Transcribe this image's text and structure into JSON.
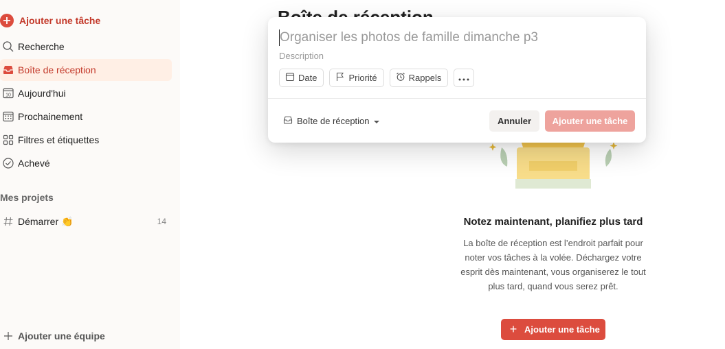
{
  "sidebar": {
    "add_task": "Ajouter une tâche",
    "items": [
      {
        "label": "Recherche",
        "icon": "search-icon"
      },
      {
        "label": "Boîte de réception",
        "icon": "inbox-icon"
      },
      {
        "label": "Aujourd'hui",
        "icon": "calendar-today-icon",
        "icon_number": "10"
      },
      {
        "label": "Prochainement",
        "icon": "calendar-grid-icon"
      },
      {
        "label": "Filtres et étiquettes",
        "icon": "filters-icon"
      },
      {
        "label": "Achevé",
        "icon": "check-circle-icon"
      }
    ],
    "projects_title": "Mes projets",
    "projects": [
      {
        "label": "Démarrer 👏",
        "count": "14",
        "icon": "hash-icon"
      }
    ],
    "add_team": "Ajouter une équipe"
  },
  "main": {
    "title": "Boîte de réception",
    "empty_title": "Notez maintenant, planifiez plus tard",
    "empty_desc": "La boîte de réception est l’endroit parfait pour noter vos tâches à la volée. Déchargez votre esprit dès maintenant, vous organiserez le tout plus tard, quand vous serez prêt.",
    "empty_button": "Ajouter une tâche"
  },
  "modal": {
    "task_name_placeholder": "Organiser les photos de famille dimanche p3",
    "description_placeholder": "Description",
    "chips": {
      "date": "Date",
      "priority": "Priorité",
      "reminders": "Rappels"
    },
    "project": "Boîte de réception",
    "cancel": "Annuler",
    "add": "Ajouter une tâche"
  },
  "colors": {
    "accent": "#dc4c3e",
    "accent_dark": "#c3392a",
    "active_bg": "#ffefe5",
    "sidebar_bg": "#fcfaf8",
    "add_disabled": "#eea39d"
  }
}
